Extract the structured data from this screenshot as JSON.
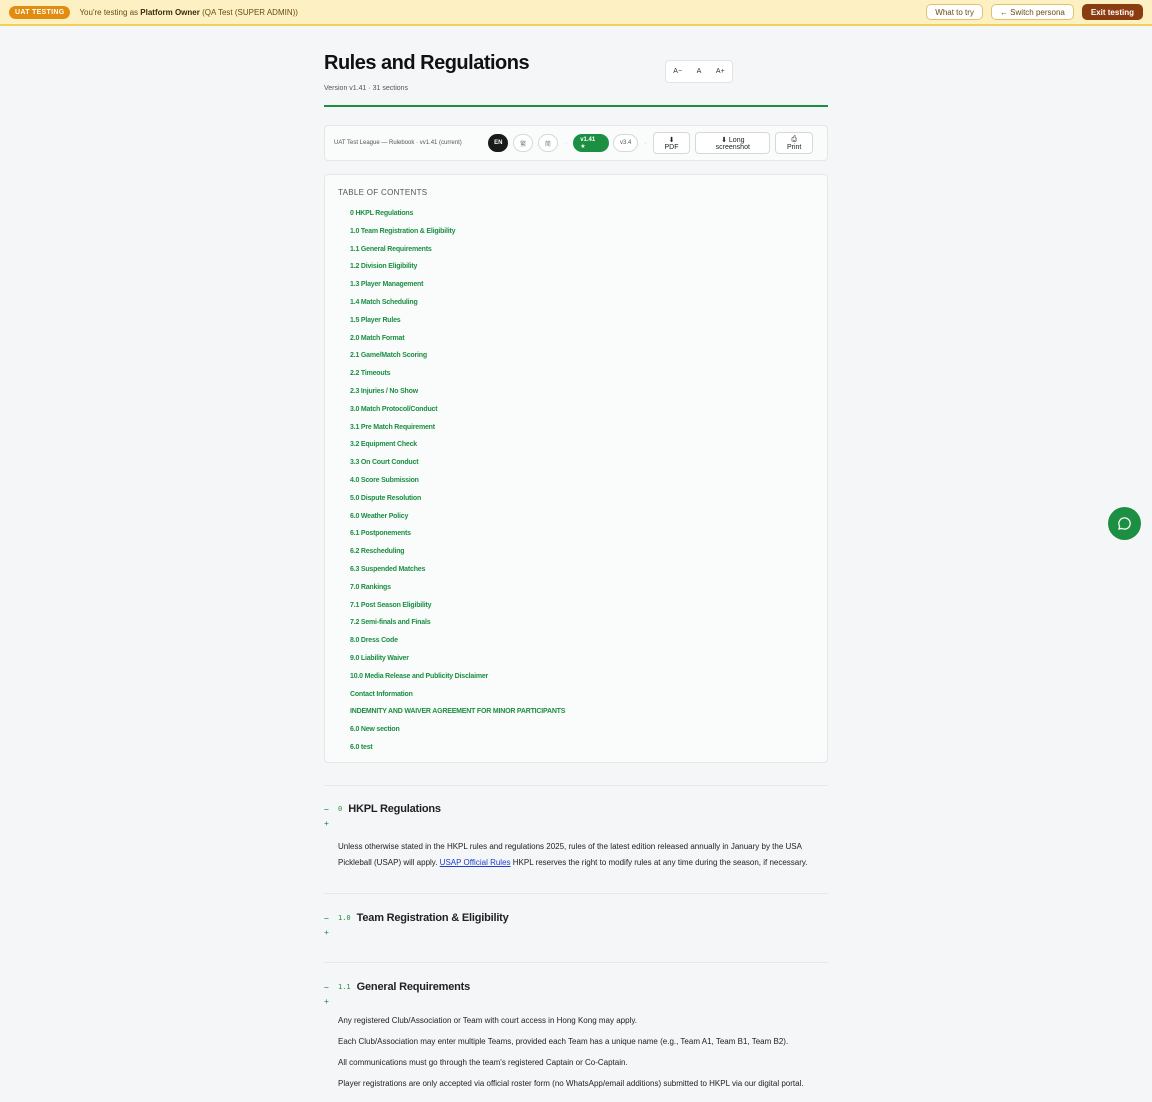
{
  "uat": {
    "badge": "UAT TESTING",
    "prefix": "You're testing as ",
    "persona": "Platform Owner",
    "role": " (QA Test (SUPER ADMIN))",
    "what_to_try": "What to try",
    "switch_persona": "← Switch persona",
    "exit": "Exit testing"
  },
  "page": {
    "title": "Rules and Regulations",
    "subtitle": "Version v1.41 · 31 sections",
    "font_decrease": "A−",
    "font_reset": "A",
    "font_increase": "A+"
  },
  "toolbar": {
    "doc_label": "UAT Test League — Rulebook · vv1.41 (current)",
    "lang_en": "EN",
    "lang_tc": "繁",
    "lang_sc": "简",
    "sep": "·",
    "version_current": "v1.41 ★",
    "version_other": "v3.4",
    "pdf": "⬇ PDF",
    "long_screenshot": "⬇ Long screenshot",
    "print": "⎙ Print"
  },
  "toc": {
    "heading": "TABLE OF CONTENTS",
    "items": [
      "0 HKPL Regulations",
      "1.0 Team Registration & Eligibility",
      "1.1 General Requirements",
      "1.2 Division Eligibility",
      "1.3 Player Management",
      "1.4 Match Scheduling",
      "1.5 Player Rules",
      "2.0 Match Format",
      "2.1 Game/Match Scoring",
      "2.2 Timeouts",
      "2.3 Injuries / No Show",
      "3.0 Match Protocol/Conduct",
      "3.1 Pre Match Requirement",
      "3.2 Equipment Check",
      "3.3 On Court Conduct",
      "4.0 Score Submission",
      "5.0 Dispute Resolution",
      "6.0 Weather Policy",
      "6.1 Postponements",
      "6.2 Rescheduling",
      "6.3 Suspended Matches",
      "7.0 Rankings",
      "7.1 Post Season Eligibility",
      "7.2 Semi-finals and Finals",
      "8.0 Dress Code",
      "9.0 Liability Waiver",
      "10.0 Media Release and Publicity Disclaimer",
      "Contact Information",
      "INDEMNITY AND WAIVER AGREEMENT FOR MINOR PARTICIPANTS",
      "6.0 New section",
      "6.0 test"
    ]
  },
  "sections": {
    "toggle_minus": "−",
    "toggle_plus": "+",
    "s0": {
      "num": "0",
      "title": "HKPL Regulations",
      "body_before": "Unless otherwise stated in the HKPL rules and regulations 2025, rules of the latest edition released annually in January by the USA Pickleball (USAP) will apply. ",
      "link": "USAP Official Rules",
      "body_after": " HKPL reserves the right to modify rules at any time during the season, if necessary."
    },
    "s1": {
      "num": "1.0",
      "title": "Team Registration & Eligibility"
    },
    "s2": {
      "num": "1.1",
      "title": "General Requirements",
      "p1": "Any registered Club/Association or Team with court access in Hong Kong may apply.",
      "p2": "Each Club/Association may enter multiple Teams, provided each Team has a unique name (e.g., Team A1, Team B1, Team B2).",
      "p3": "All communications must go through the team's registered Captain or Co-Captain.",
      "p4": "Player registrations are only accepted via official roster form (no WhatsApp/email additions) submitted to HKPL via our digital portal."
    }
  }
}
